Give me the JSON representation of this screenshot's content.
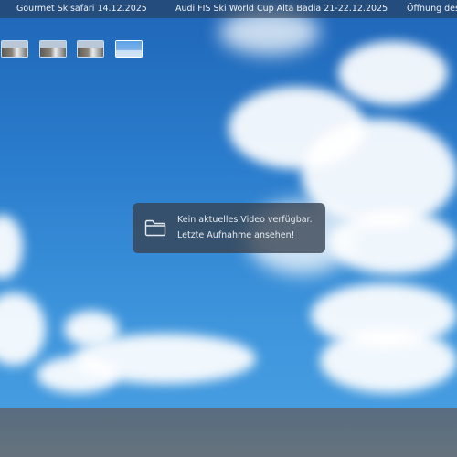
{
  "ticker": {
    "items": [
      "Gourmet Skisafari 14.12.2025",
      "Audi FIS Ski World Cup Alta Badia 21-22.12.2025",
      "Öffnung des S"
    ]
  },
  "thumbnails": {
    "count": 4,
    "active_index": 3
  },
  "notice": {
    "icon": "folder-icon",
    "message": "Kein aktuelles Video verfügbar.",
    "link_text": "Letzte Aufnahme ansehen!"
  },
  "colors": {
    "sky_top": "#1f66b8",
    "sky_bottom": "#4aa0e2",
    "overlay": "#374150",
    "text": "#e6ebf1"
  }
}
